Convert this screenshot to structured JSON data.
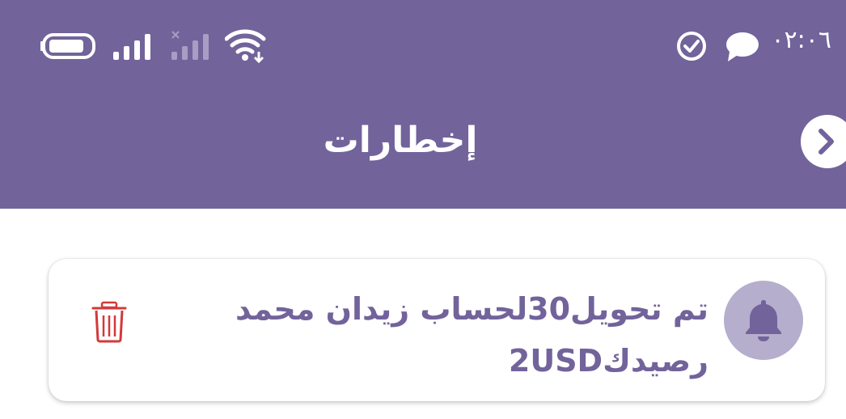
{
  "status_bar": {
    "time": "٠٢:٠٦",
    "icons": [
      "check-circle-icon",
      "chat-bubble-icon",
      "wifi-icon",
      "signal-sim2-icon",
      "signal-icon",
      "battery-icon"
    ]
  },
  "header": {
    "title": "إخطارات",
    "back_icon": "chevron-right-icon"
  },
  "notifications": [
    {
      "icon": "bell-icon",
      "message": "تم تحويل30لحساب زيدان محمد رصيدك2USD",
      "delete_icon": "trash-icon"
    }
  ],
  "colors": {
    "header_bg": "#72639b",
    "accent": "#72639b",
    "avatar_bg": "#b5aecd",
    "delete": "#d23a3a"
  }
}
